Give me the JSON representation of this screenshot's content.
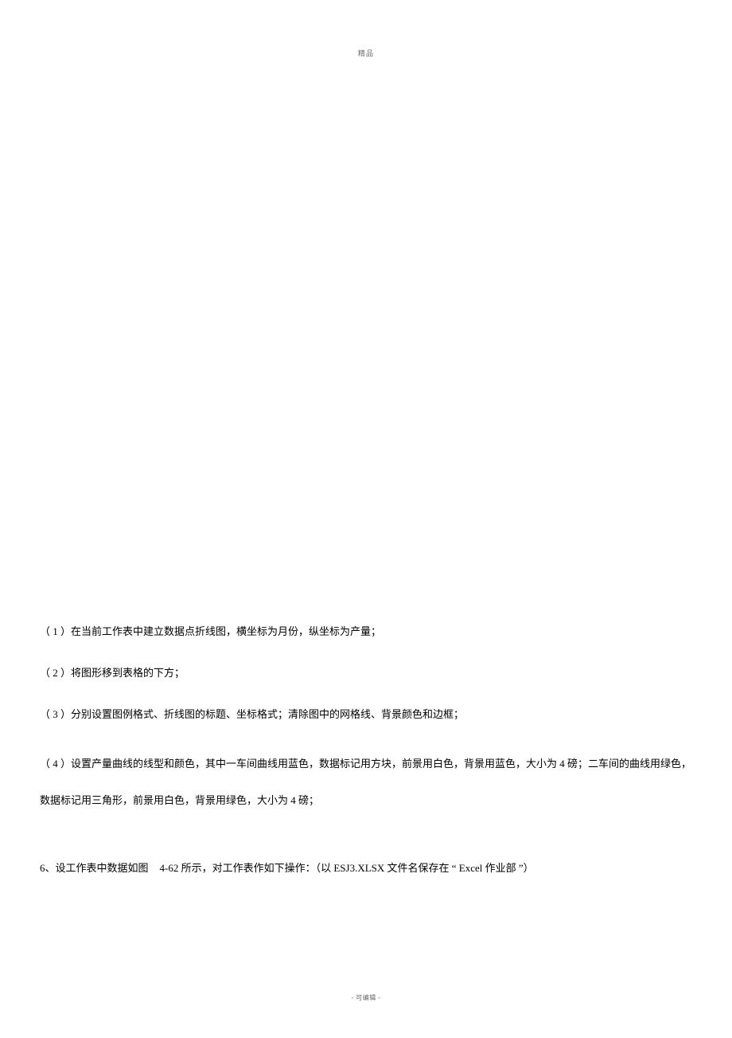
{
  "header": "精品",
  "footer": "- 可编辑 -",
  "items": {
    "i1": "（ 1 ）在当前工作表中建立数据点折线图，横坐标为月份，纵坐标为产量；",
    "i2": "（ 2 ）将图形移到表格的下方；",
    "i3": "（ 3 ）分别设置图例格式、折线图的标题、坐标格式；清除图中的网格线、背景颜色和边框；",
    "i4": "（ 4 ）设置产量曲线的线型和颜色，其中一车间曲线用蓝色，数据标记用方块，前景用白色，背景用蓝色，大小为 4 磅；二车间的曲线用绿色，数据标记用三角形，前景用白色，背景用绿色，大小为 4 磅；",
    "q6_a": "6、设工作表中数据如图",
    "q6_b": "4-62 所示，对工作表作如下操作：（以 ESJ3.XLSX 文件名保存在 “ Excel 作业部 ”）"
  }
}
